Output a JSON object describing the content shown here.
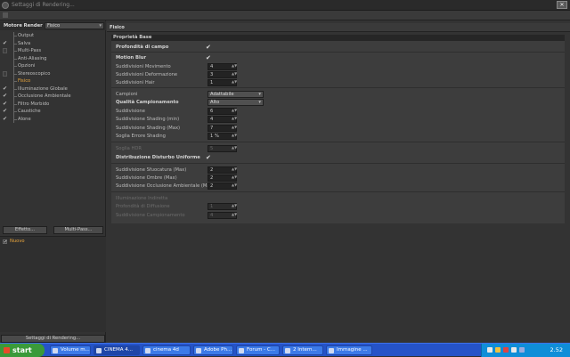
{
  "window": {
    "title": "Settaggi di Rendering..."
  },
  "left": {
    "engine_label": "Motore Render",
    "engine_value": "Fisico",
    "tree": [
      {
        "label": "Output",
        "check": "",
        "selected": false
      },
      {
        "label": "Salva",
        "check": "✔",
        "selected": false
      },
      {
        "label": "Multi-Pass",
        "check": "box",
        "selected": false
      },
      {
        "label": "Anti-Aliasing",
        "check": "",
        "selected": false
      },
      {
        "label": "Opzioni",
        "check": "",
        "selected": false
      },
      {
        "label": "Stereoscopico",
        "check": "box",
        "selected": false
      },
      {
        "label": "Fisico",
        "check": "",
        "selected": true
      },
      {
        "label": "Illuminazione Globale",
        "check": "✔",
        "selected": false
      },
      {
        "label": "Occlusione Ambientale",
        "check": "✔",
        "selected": false
      },
      {
        "label": "Filtro Morbido",
        "check": "✔",
        "selected": false
      },
      {
        "label": "Caustiche",
        "check": "✔",
        "selected": false
      },
      {
        "label": "Alone",
        "check": "✔",
        "selected": false
      }
    ],
    "effect_button": "Effetto...",
    "multipass_button": "Multi-Pass...",
    "effect_item": "Nuovo",
    "settings_button": "Settaggi di Rendering..."
  },
  "right": {
    "header": "Fisico",
    "section": "Proprietà Base",
    "rows": [
      {
        "label": "Profondità di campo",
        "bold": true,
        "type": "check",
        "value": "✔"
      },
      {
        "label": "Motion Blur",
        "bold": true,
        "type": "check",
        "value": "✔"
      },
      {
        "label": "Suddivisioni Movimento",
        "type": "num",
        "value": "4"
      },
      {
        "label": "Suddivisioni Deformazione",
        "type": "num",
        "value": "3"
      },
      {
        "label": "Suddivisioni Hair",
        "type": "num",
        "value": "1"
      },
      {
        "label": "Campioni",
        "type": "dd",
        "value": "Adattabile"
      },
      {
        "label": "Qualità Campionamento",
        "bold": true,
        "type": "dd",
        "value": "Alto"
      },
      {
        "label": "Suddivisione",
        "type": "num",
        "value": "6"
      },
      {
        "label": "Suddivisione Shading (min)",
        "type": "num",
        "value": "4"
      },
      {
        "label": "Suddivisione Shading (Max)",
        "type": "num",
        "value": "7"
      },
      {
        "label": "Soglia Errore Shading",
        "type": "num",
        "value": "1 %"
      },
      {
        "label": "Soglia HDR",
        "dim": true,
        "type": "num",
        "value": "5"
      },
      {
        "label": "Distribuzione Disturbo Uniforme",
        "bold": true,
        "type": "check",
        "value": "✔"
      },
      {
        "label": "Suddivisione Sfuocatura (Max)",
        "type": "num",
        "value": "2"
      },
      {
        "label": "Suddivisione Ombre (Max)",
        "type": "num",
        "value": "2"
      },
      {
        "label": "Suddivisione Occlusione Ambientale (Max)",
        "type": "num",
        "value": "2"
      },
      {
        "label": "Illuminazione Indiretta",
        "dim": true,
        "type": "check",
        "value": ""
      },
      {
        "label": "Profondità di Diffusione",
        "dim": true,
        "type": "num",
        "value": "1"
      },
      {
        "label": "Suddivisione Campionamento",
        "dim": true,
        "type": "num",
        "value": "4"
      }
    ]
  },
  "taskbar": {
    "start": "start",
    "tasks": [
      "Volume m...",
      "CINEMA 4...",
      "cinema 4d",
      "Adobe Ph...",
      "Forum - C...",
      "2 Intern...",
      "Immagine ..."
    ],
    "clock": "2.52"
  }
}
